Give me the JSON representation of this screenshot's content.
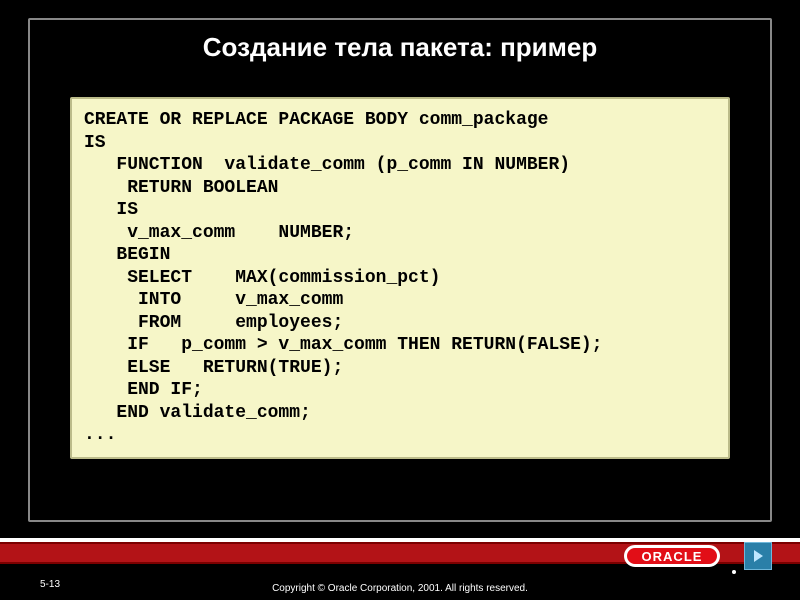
{
  "slide": {
    "title": "Создание тела пакета: пример",
    "code": "CREATE OR REPLACE PACKAGE BODY comm_package\nIS\n   FUNCTION  validate_comm (p_comm IN NUMBER)\n    RETURN BOOLEAN\n   IS\n    v_max_comm    NUMBER;\n   BEGIN\n    SELECT    MAX(commission_pct)\n     INTO     v_max_comm\n     FROM     employees;\n    IF   p_comm > v_max_comm THEN RETURN(FALSE);\n    ELSE   RETURN(TRUE);\n    END IF;\n   END validate_comm;\n...",
    "number": "5-13",
    "copyright": "Copyright © Oracle Corporation, 2001. All rights reserved."
  },
  "logo": {
    "text": "ORACLE"
  }
}
